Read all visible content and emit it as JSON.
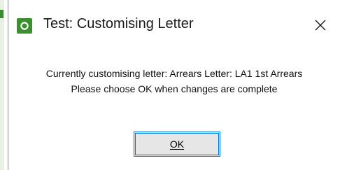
{
  "window": {
    "title": "Test: Customising Letter",
    "icon": "app-logo-icon",
    "close_icon": "close-icon",
    "accent": "#3c8f2f"
  },
  "message": {
    "line1": "Currently customising letter: Arrears Letter: LA1 1st Arrears",
    "line2": "Please choose OK when changes are complete"
  },
  "buttons": {
    "ok_label": "OK",
    "ok_border_color": "#0078d7"
  }
}
